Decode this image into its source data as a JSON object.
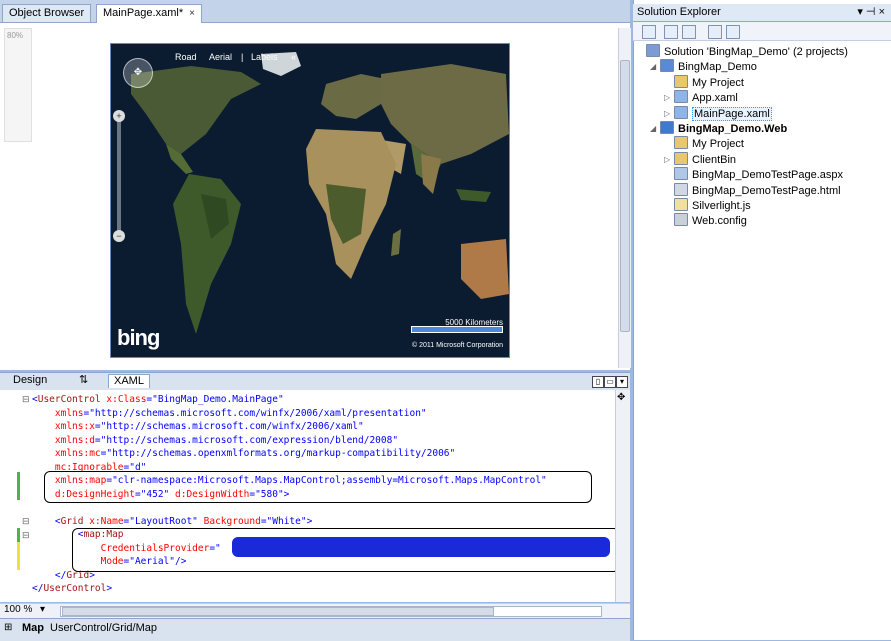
{
  "tabs": [
    {
      "label": "Object Browser"
    },
    {
      "label": "MainPage.xaml*",
      "close": "×"
    }
  ],
  "designer": {
    "zoom_label": "80%",
    "map": {
      "mode_links": [
        "Road",
        "Aerial",
        "|",
        "Labels",
        "«"
      ],
      "scale_label": "5000 Kilometers",
      "copyright": "© 2011 Microsoft Corporation",
      "logo": "bing"
    }
  },
  "view_tabs": {
    "design": "Design",
    "swap": "⇅",
    "xaml": "XAML"
  },
  "code": {
    "lines": [
      {
        "parts": [
          [
            "blue",
            "<"
          ],
          [
            "maroon",
            "UserControl"
          ],
          [
            "red",
            " x:Class"
          ],
          [
            "blue",
            "=\"BingMap_Demo.MainPage\""
          ]
        ]
      },
      {
        "parts": [
          [
            "red",
            "    xmlns"
          ],
          [
            "blue",
            "=\"http://schemas.microsoft.com/winfx/2006/xaml/presentation\""
          ]
        ]
      },
      {
        "parts": [
          [
            "red",
            "    xmlns:x"
          ],
          [
            "blue",
            "=\"http://schemas.microsoft.com/winfx/2006/xaml\""
          ]
        ]
      },
      {
        "parts": [
          [
            "red",
            "    xmlns:d"
          ],
          [
            "blue",
            "=\"http://schemas.microsoft.com/expression/blend/2008\""
          ]
        ]
      },
      {
        "parts": [
          [
            "red",
            "    xmlns:mc"
          ],
          [
            "blue",
            "=\"http://schemas.openxmlformats.org/markup-compatibility/2006\""
          ]
        ]
      },
      {
        "parts": [
          [
            "red",
            "    mc:Ignorable"
          ],
          [
            "blue",
            "=\"d\""
          ]
        ]
      },
      {
        "parts": [
          [
            "red",
            "    xmlns:map"
          ],
          [
            "blue",
            "=\"clr-namespace:Microsoft.Maps.MapControl;assembly=Microsoft.Maps.MapControl\""
          ]
        ]
      },
      {
        "parts": [
          [
            "red",
            "    d:DesignHeight"
          ],
          [
            "blue",
            "=\"452\""
          ],
          [
            "red",
            " d:DesignWidth"
          ],
          [
            "blue",
            "=\"580\">"
          ]
        ]
      },
      {
        "parts": [
          [
            "blue",
            ""
          ]
        ]
      },
      {
        "parts": [
          [
            "blue",
            "    <"
          ],
          [
            "maroon",
            "Grid"
          ],
          [
            "red",
            " x:Name"
          ],
          [
            "blue",
            "=\"LayoutRoot\""
          ],
          [
            "red",
            " Background"
          ],
          [
            "blue",
            "=\"White\">"
          ]
        ]
      },
      {
        "parts": [
          [
            "blue",
            "        <"
          ],
          [
            "maroon",
            "map:Map"
          ]
        ]
      },
      {
        "parts": [
          [
            "red",
            "            CredentialsProvider"
          ],
          [
            "blue",
            "=\""
          ]
        ]
      },
      {
        "parts": [
          [
            "red",
            "            Mode"
          ],
          [
            "blue",
            "=\"Aerial\"/>"
          ]
        ]
      },
      {
        "parts": [
          [
            "blue",
            "    </"
          ],
          [
            "maroon",
            "Grid"
          ],
          [
            "blue",
            ">"
          ]
        ]
      },
      {
        "parts": [
          [
            "blue",
            "</"
          ],
          [
            "maroon",
            "UserControl"
          ],
          [
            "blue",
            ">"
          ]
        ]
      }
    ]
  },
  "bottom": {
    "zoom_value": "100 %",
    "breadcrumb_element": "Map",
    "breadcrumb_path": "UserControl/Grid/Map"
  },
  "solution_explorer": {
    "title": "Solution Explorer",
    "pin": "▾ ⊣ ×",
    "items": [
      {
        "label": "Solution 'BingMap_Demo' (2 projects)",
        "indent": 0,
        "icon": "solution-icon",
        "bold": false
      },
      {
        "label": "BingMap_Demo",
        "indent": 1,
        "icon": "project-icon",
        "bold": false,
        "expander": "◢"
      },
      {
        "label": "My Project",
        "indent": 2,
        "icon": "folder-properties-icon",
        "bold": false
      },
      {
        "label": "App.xaml",
        "indent": 2,
        "icon": "xaml-file-icon",
        "bold": false,
        "expander": "▷"
      },
      {
        "label": "MainPage.xaml",
        "indent": 2,
        "icon": "xaml-file-icon",
        "bold": false,
        "expander": "▷",
        "selected": true
      },
      {
        "label": "BingMap_Demo.Web",
        "indent": 1,
        "icon": "web-project-icon",
        "bold": true,
        "expander": "◢"
      },
      {
        "label": "My Project",
        "indent": 2,
        "icon": "folder-properties-icon",
        "bold": false
      },
      {
        "label": "ClientBin",
        "indent": 2,
        "icon": "folder-icon",
        "bold": false,
        "expander": "▷"
      },
      {
        "label": "BingMap_DemoTestPage.aspx",
        "indent": 2,
        "icon": "aspx-file-icon",
        "bold": false
      },
      {
        "label": "BingMap_DemoTestPage.html",
        "indent": 2,
        "icon": "html-file-icon",
        "bold": false
      },
      {
        "label": "Silverlight.js",
        "indent": 2,
        "icon": "js-file-icon",
        "bold": false
      },
      {
        "label": "Web.config",
        "indent": 2,
        "icon": "config-file-icon",
        "bold": false
      }
    ]
  },
  "colors": {
    "accent": "#3399ff",
    "map_ocean": "#0a1a2e",
    "redaction": "#1a2ad8"
  }
}
